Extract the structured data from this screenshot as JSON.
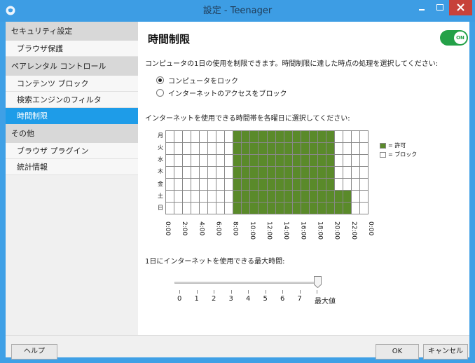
{
  "window": {
    "title": "設定 - Teenager"
  },
  "sidebar": {
    "sections": [
      {
        "header": "セキュリティ設定",
        "items": [
          "ブラウザ保護"
        ]
      },
      {
        "header": "ペアレンタル コントロール",
        "items": [
          "コンテンツ ブロック",
          "検索エンジンのフィルタ",
          "時間制限"
        ]
      },
      {
        "header": "その他",
        "items": [
          "ブラウザ プラグイン",
          "統計情報"
        ]
      }
    ],
    "selected": "時間制限"
  },
  "main": {
    "title": "時間制限",
    "toggle": {
      "label": "ON",
      "state": true,
      "color": "#24a148"
    },
    "description": "コンピュータの1日の使用を制限できます。時間制限に達した時点の処理を選択してください:",
    "options": [
      {
        "label": "コンピュータをロック",
        "selected": true
      },
      {
        "label": "インターネットのアクセスをブロック",
        "selected": false
      }
    ],
    "schedule_label": "インターネットを使用できる時間帯を各曜日に選択してください:",
    "schedule": {
      "days": [
        "月",
        "火",
        "水",
        "木",
        "金",
        "土",
        "日"
      ],
      "hour_labels": [
        "0:00",
        "2:00",
        "4:00",
        "6:00",
        "8:00",
        "10:00",
        "12:00",
        "14:00",
        "16:00",
        "18:00",
        "20:00",
        "22:00",
        "0:00"
      ],
      "allowed_ranges": [
        [
          8,
          20
        ],
        [
          8,
          20
        ],
        [
          8,
          20
        ],
        [
          8,
          20
        ],
        [
          8,
          20
        ],
        [
          8,
          22
        ],
        [
          8,
          22
        ]
      ],
      "allow_color": "#5a8a2a"
    },
    "legend": {
      "allow": "= 許可",
      "block": "= ブロック"
    },
    "max_time_label": "1日にインターネットを使用できる最大時間:",
    "slider": {
      "ticks": [
        "0",
        "1",
        "2",
        "3",
        "4",
        "5",
        "6",
        "7",
        "最大値"
      ],
      "value": "最大値"
    }
  },
  "buttons": {
    "help": "ヘルプ",
    "ok": "OK",
    "cancel": "キャンセル"
  }
}
